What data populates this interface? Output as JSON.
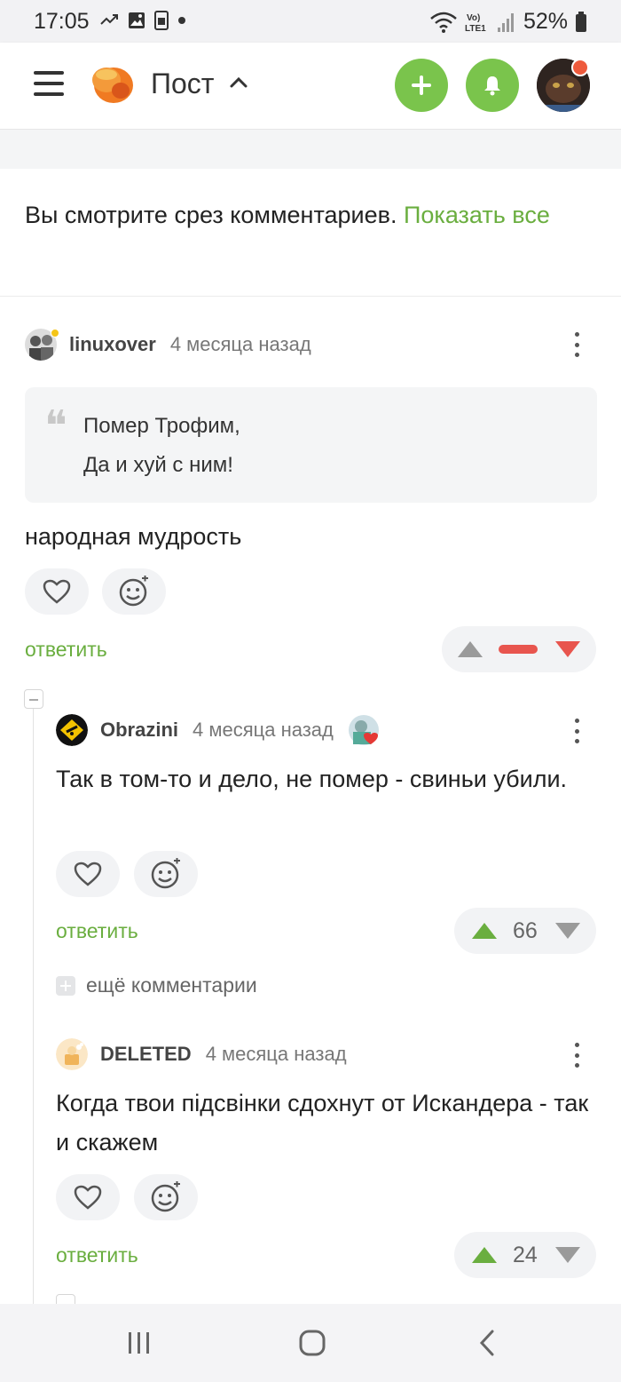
{
  "status_bar": {
    "time": "17:05",
    "battery": "52%",
    "network": "LTE1",
    "icons_left": [
      "missed-call-icon",
      "image-icon",
      "sim-icon",
      "dot-icon"
    ],
    "icons_right": [
      "wifi-icon",
      "volte-icon",
      "signal-icon",
      "battery-icon"
    ]
  },
  "header": {
    "title": "Пост",
    "add_icon": "plus-icon",
    "notifications_icon": "bell-icon",
    "accent_color": "#7ac44c",
    "badge_color": "#ee5a3c"
  },
  "notice": {
    "text": "Вы смотрите срез комментариев. ",
    "link": "Показать все"
  },
  "comments": [
    {
      "author": "linuxover",
      "time": "4 месяца назад",
      "quote_lines": [
        "Помер Трофим,",
        "Да и хуй с ним!"
      ],
      "text": "народная мудрость",
      "reply": "ответить",
      "rating": "—",
      "rating_color": "#e8554e"
    },
    {
      "author": "Obrazini",
      "time": "4 месяца назад",
      "text": "Так в том-то и дело, не помер - свиньи убили.",
      "reply": "ответить",
      "rating": "66"
    },
    {
      "author": "DELETED",
      "time": "4 месяца назад",
      "text": "Когда твои підсвінки сдохнут от Искандера - так и скажем",
      "reply": "ответить",
      "rating": "24"
    }
  ],
  "more_comments": "ещё комментарии",
  "colors": {
    "link_green": "#6aae3f",
    "up_green": "#6aae3f",
    "down_gray": "#9a9a9a"
  }
}
